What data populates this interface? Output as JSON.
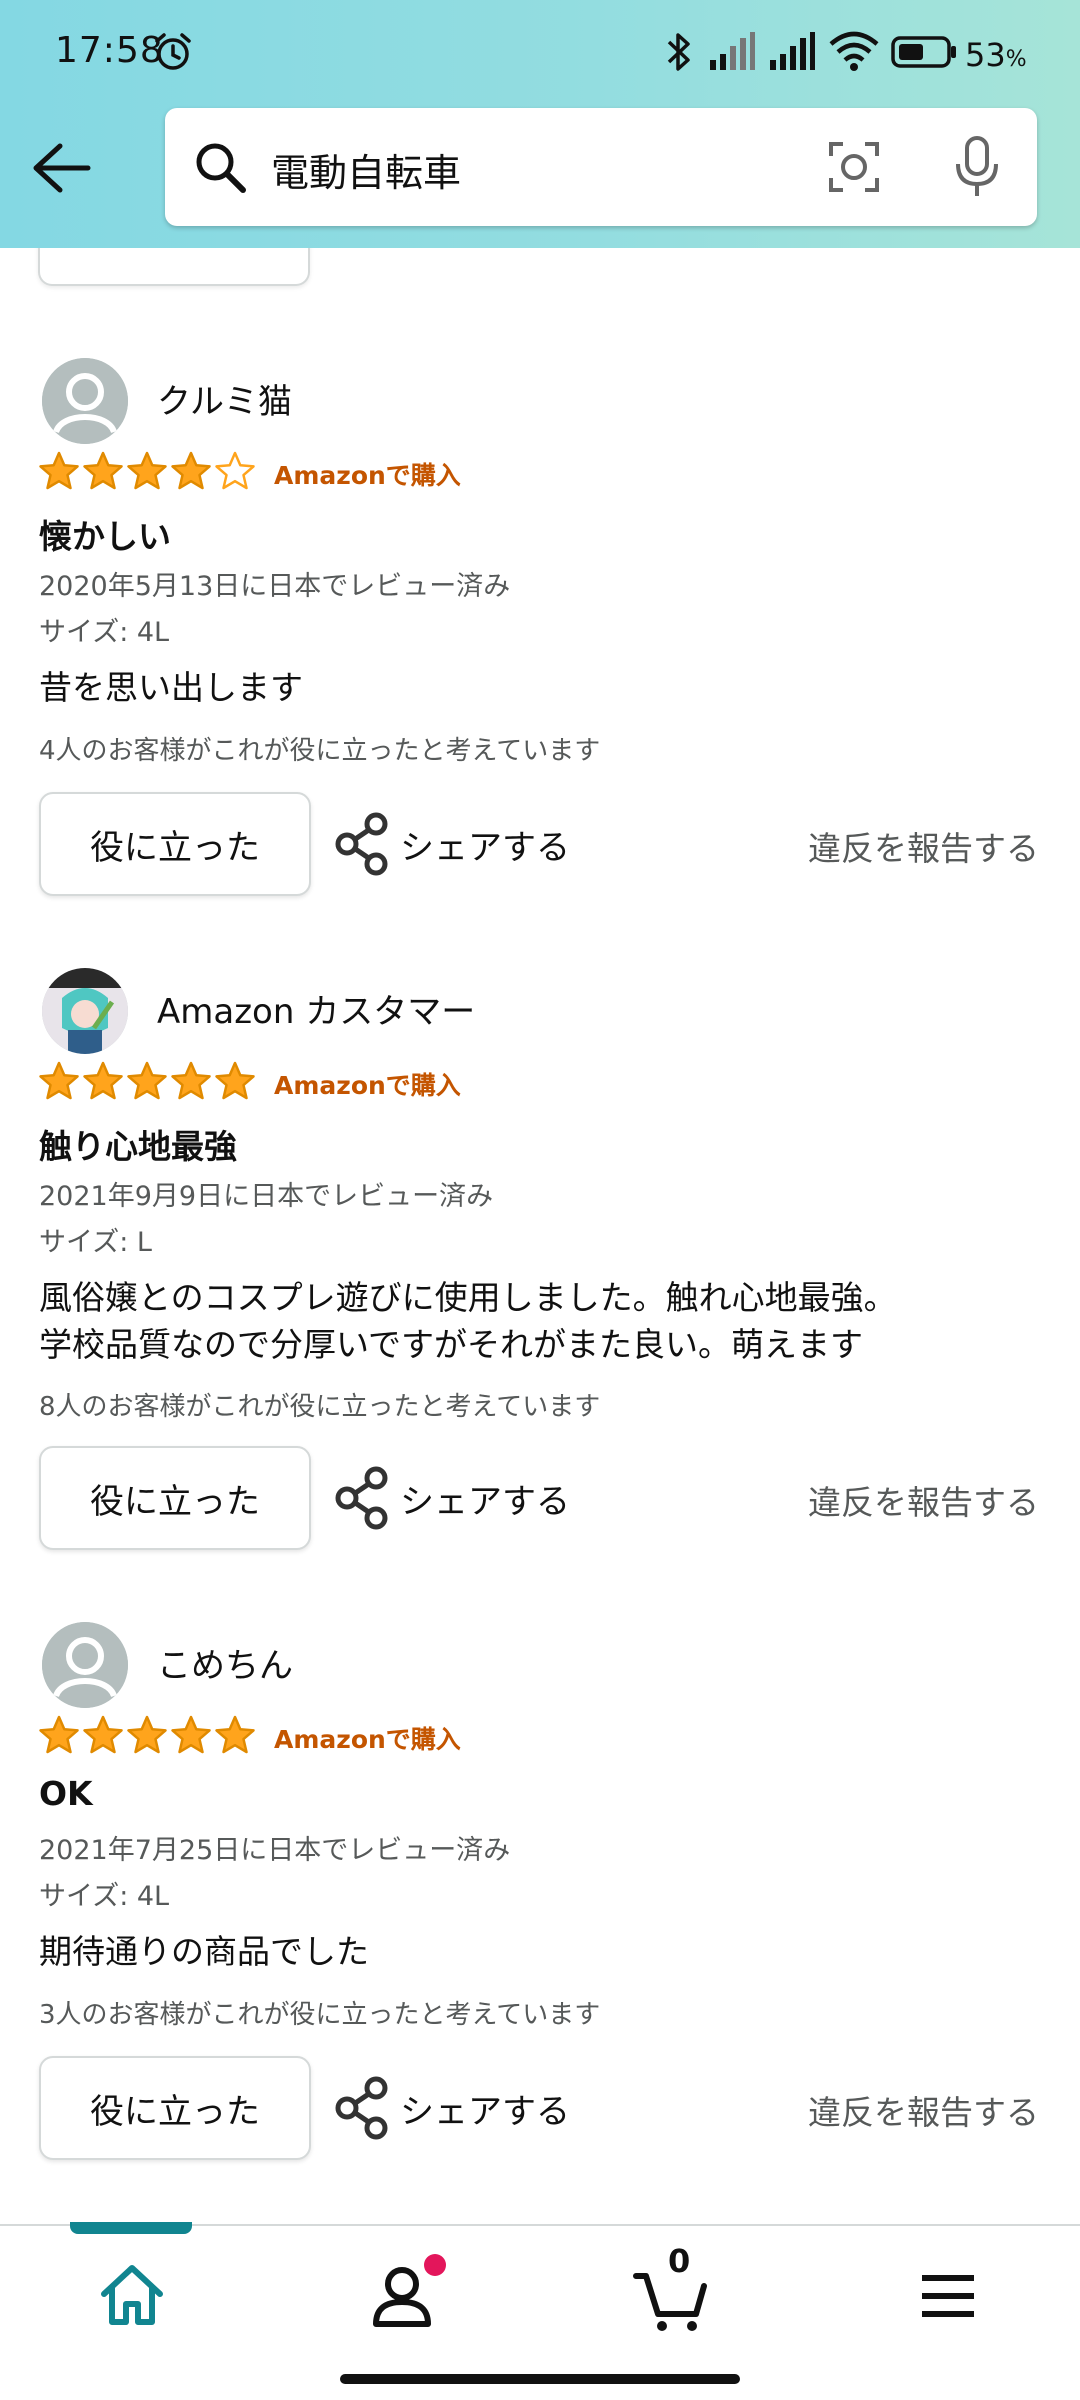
{
  "status_bar": {
    "time": "17:58",
    "battery": "53",
    "battery_unit": "%"
  },
  "search": {
    "query": "電動自転車"
  },
  "colors": {
    "accent": "#118590",
    "star": "#ffa41c",
    "verified": "#c45500",
    "badge": "#e3165b"
  },
  "reviews": [
    {
      "reviewer": "クルミ猫",
      "avatar": "default-avatar-icon",
      "rating": 4,
      "verified": "Amazonで購入",
      "title": "懐かしい",
      "date": "2020年5月13日に日本でレビュー済み",
      "size": "サイズ: 4L",
      "body_lines": [
        "昔を思い出します"
      ],
      "helpful_count": "4人のお客様がこれが役に立ったと考えています",
      "helpful_button": "役に立った",
      "share": "シェアする",
      "report": "違反を報告する"
    },
    {
      "reviewer": "Amazon カスタマー",
      "avatar": "anime-character-avatar",
      "rating": 5,
      "verified": "Amazonで購入",
      "title": "触り心地最強",
      "date": "2021年9月9日に日本でレビュー済み",
      "size": "サイズ: L",
      "body_lines": [
        "風俗嬢とのコスプレ遊びに使用しました。触れ心地最強。",
        "学校品質なので分厚いですがそれがまた良い。萌えます"
      ],
      "helpful_count": "8人のお客様がこれが役に立ったと考えています",
      "helpful_button": "役に立った",
      "share": "シェアする",
      "report": "違反を報告する"
    },
    {
      "reviewer": "こめちん",
      "avatar": "default-avatar-icon",
      "rating": 5,
      "verified": "Amazonで購入",
      "title": "OK",
      "date": "2021年7月25日に日本でレビュー済み",
      "size": "サイズ: 4L",
      "body_lines": [
        "期待通りの商品でした"
      ],
      "helpful_count": "3人のお客様がこれが役に立ったと考えています",
      "helpful_button": "役に立った",
      "share": "シェアする",
      "report": "違反を報告する"
    }
  ],
  "bottom_nav": {
    "items": [
      "home-icon",
      "account-icon",
      "cart-icon",
      "menu-icon"
    ],
    "cart_count": "0"
  }
}
